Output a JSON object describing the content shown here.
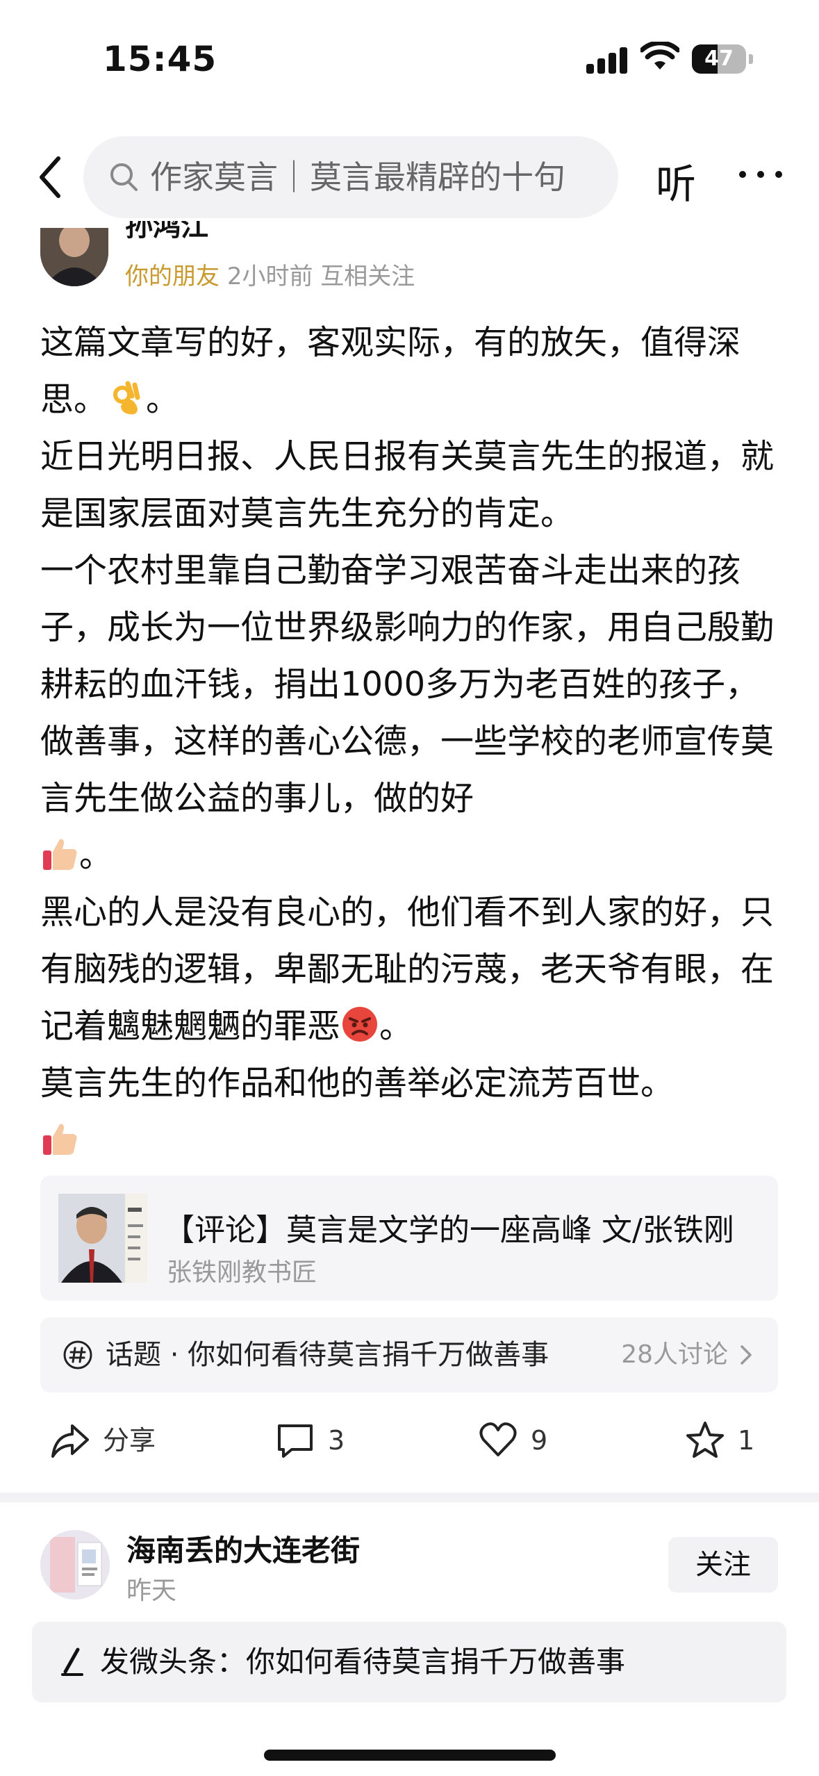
{
  "status_bar": {
    "time": "15:45",
    "battery": "47",
    "battery_level": 0.47
  },
  "nav": {
    "search_text": "作家莫言｜莫言最精辟的十句",
    "listen_label": "听"
  },
  "post": {
    "author_name": "孙鸿江",
    "relation": "你的朋友",
    "time": "2小时前",
    "follow_status": "互相关注",
    "paragraphs": [
      {
        "text": "这篇文章写的好，客观实际，有的放矢，值得深思。",
        "emoji": "ok-hand-emoji",
        "tail": "。"
      },
      {
        "text": "近日光明日报、人民日报有关莫言先生的报道，就是国家层面对莫言先生充分的肯定。"
      },
      {
        "text": "一个农村里靠自己勤奋学习艰苦奋斗走出来的孩子，成长为一位世界级影响力的作家，用自己殷勤耕耘的血汗钱，捐出1000多万为老百姓的孩子，做善事，这样的善心公德，一些学校的老师宣传莫言先生做公益的事儿，做的好",
        "emoji": "thumbs-up-emoji",
        "tail": "。"
      },
      {
        "text": "黑心的人是没有良心的，他们看不到人家的好，只有脑残的逻辑，卑鄙无耻的污蔑，老天爷有眼，在记着魑魅魍魉的罪恶",
        "emoji": "angry-face-emoji",
        "tail": "。"
      },
      {
        "text": "莫言先生的作品和他的善举必定流芳百世。",
        "emoji_block": "thumbs-up-emoji"
      }
    ]
  },
  "linked_article": {
    "title": "【评论】莫言是文学的一座高峰 文/张铁刚",
    "source": "张铁刚教书匠"
  },
  "topic": {
    "text": "话题 · 你如何看待莫言捐千万做善事",
    "count": "28人讨论"
  },
  "actions": {
    "share": "分享",
    "comments": "3",
    "likes": "9",
    "favorites": "1"
  },
  "next_post": {
    "author_name": "海南丢的大连老街",
    "time": "昨天",
    "follow_label": "关注"
  },
  "compose": {
    "text": "发微头条：你如何看待莫言捐千万做善事"
  }
}
